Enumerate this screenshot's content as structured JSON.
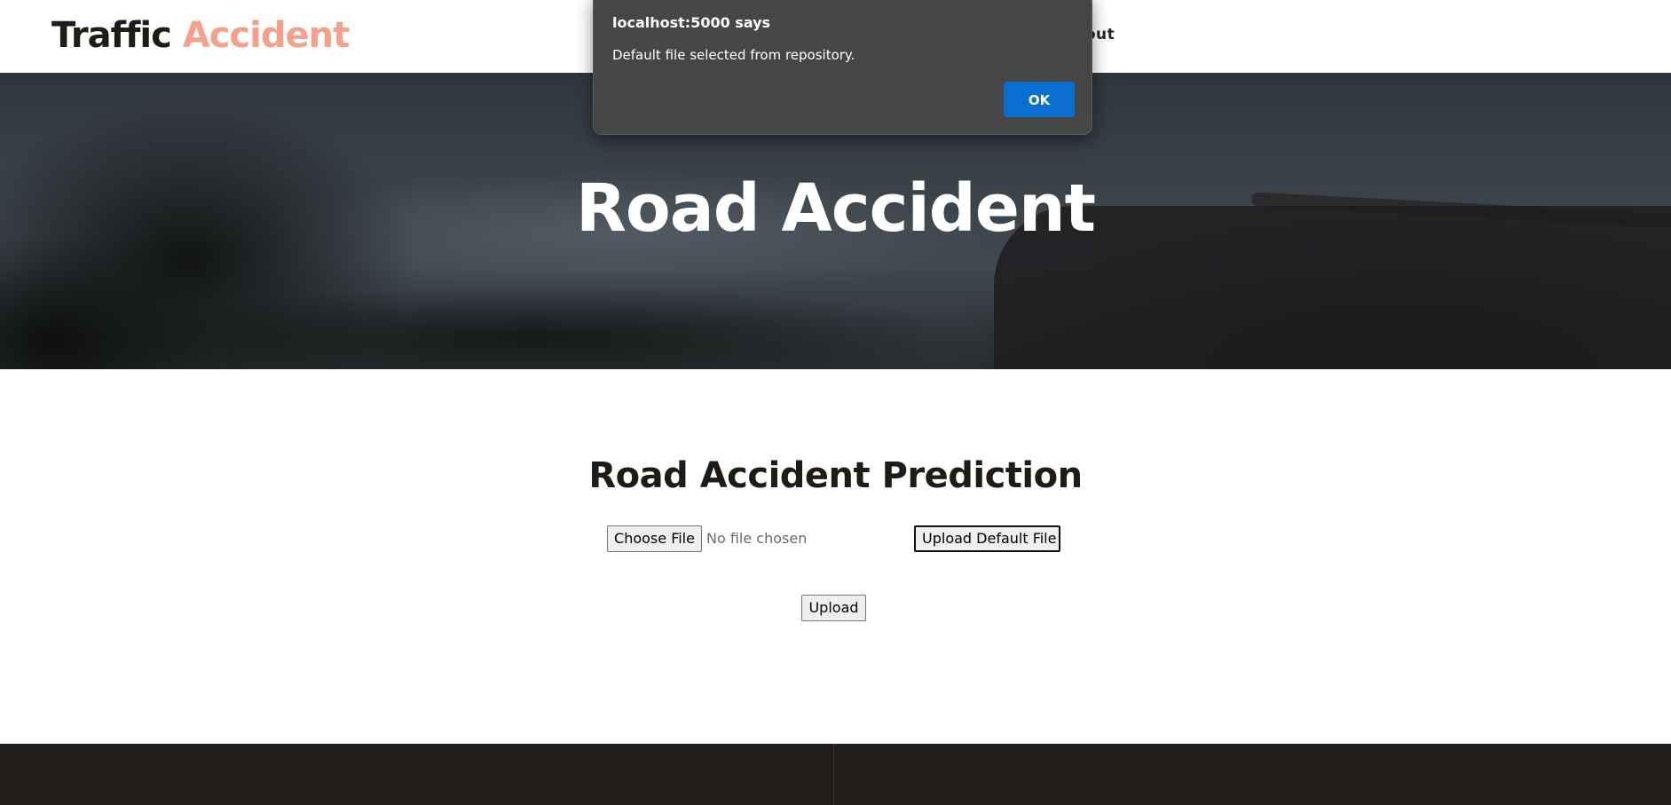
{
  "header": {
    "brand_main": "Traffic ",
    "brand_accent": "Accident",
    "nav_logout": "ogout"
  },
  "hero": {
    "title": "Road Accident"
  },
  "main": {
    "title": "Road Accident Prediction",
    "choose_file_label": "Choose File",
    "no_file_text": "No file chosen",
    "upload_default_label": "Upload Default File",
    "upload_label": "Upload"
  },
  "dialog": {
    "title": "localhost:5000 says",
    "message": "Default file selected from repository.",
    "ok_label": "OK"
  },
  "colors": {
    "brand_accent": "#f3a08c",
    "dialog_ok": "#0b6fd1",
    "footer": "#221e1b"
  }
}
